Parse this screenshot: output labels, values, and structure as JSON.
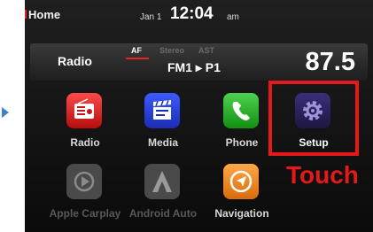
{
  "status": {
    "home": "Home",
    "date": "Jan 1",
    "time": "12:04",
    "ampm": "am"
  },
  "radio": {
    "label": "Radio",
    "af": "AF",
    "stereo": "Stereo",
    "ast": "AST",
    "preset": "FM1 ▸ P1",
    "frequency": "87.5"
  },
  "apps": [
    {
      "label": "Radio",
      "icon": "radio-icon"
    },
    {
      "label": "Media",
      "icon": "media-icon"
    },
    {
      "label": "Phone",
      "icon": "phone-icon"
    },
    {
      "label": "Setup",
      "icon": "gear-icon"
    },
    {
      "label": "Apple Carplay",
      "icon": "carplay-icon"
    },
    {
      "label": "Android Auto",
      "icon": "android-auto-icon"
    },
    {
      "label": "Navigation",
      "icon": "navigation-icon"
    }
  ],
  "annotation": {
    "text": "Touch"
  },
  "colors": {
    "highlight": "#e51919",
    "arrow": "#3d83c4"
  }
}
